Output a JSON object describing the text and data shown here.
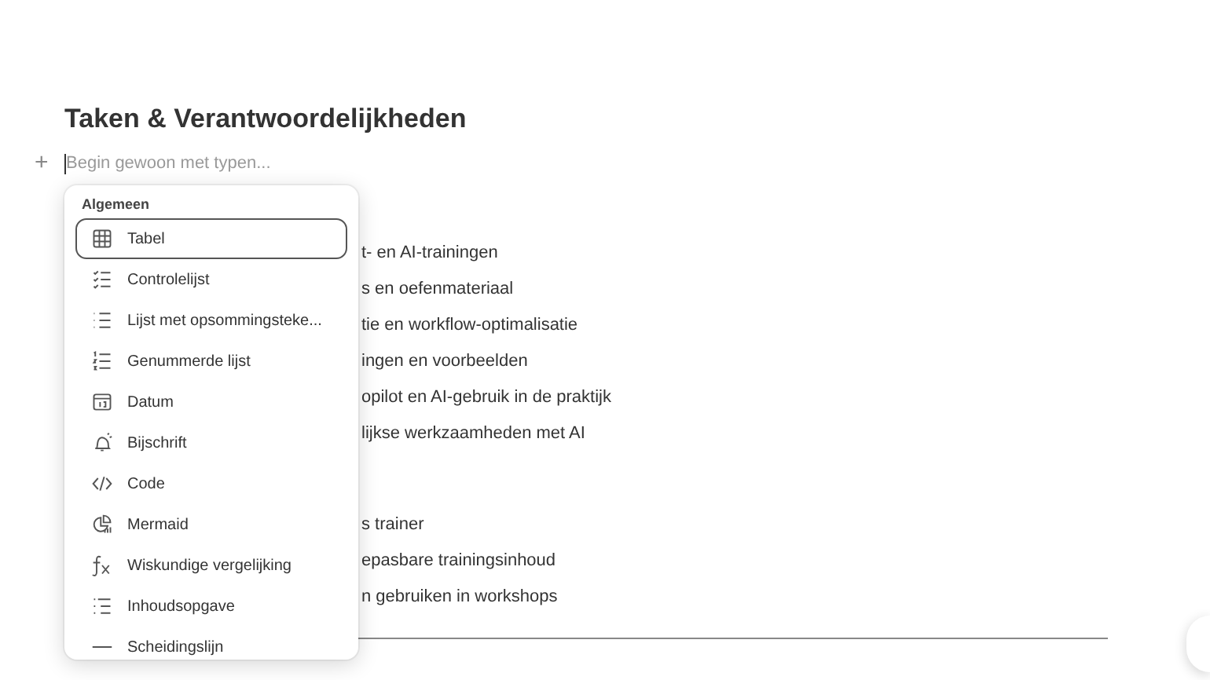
{
  "page": {
    "title": "Taken & Verantwoordelijkheden",
    "placeholder": "Begin gewoon met typen...",
    "add_symbol": "+"
  },
  "background_blocks": [
    {
      "lines": [
        "t- en AI-trainingen",
        "s en oefenmateriaal",
        "tie en workflow-optimalisatie",
        "ingen en voorbeelden",
        "opilot en AI-gebruik in de praktijk",
        "lijkse werkzaamheden met AI"
      ]
    },
    {
      "lines": [
        "s trainer",
        "epasbare trainingsinhoud",
        "n gebruiken in workshops"
      ]
    }
  ],
  "menu": {
    "section": "Algemeen",
    "items": [
      {
        "label": "Tabel",
        "kind": "table",
        "selected": true
      },
      {
        "label": "Controlelijst",
        "kind": "checklist",
        "selected": false
      },
      {
        "label": "Lijst met opsommingsteke...",
        "kind": "bullets",
        "selected": false
      },
      {
        "label": "Genummerde lijst",
        "kind": "numbered",
        "selected": false
      },
      {
        "label": "Datum",
        "kind": "date",
        "selected": false
      },
      {
        "label": "Bijschrift",
        "kind": "callout",
        "selected": false
      },
      {
        "label": "Code",
        "kind": "code",
        "selected": false
      },
      {
        "label": "Mermaid",
        "kind": "mermaid",
        "selected": false
      },
      {
        "label": "Wiskundige vergelijking",
        "kind": "math",
        "selected": false
      },
      {
        "label": "Inhoudsopgave",
        "kind": "toc",
        "selected": false
      },
      {
        "label": "Scheidingslijn",
        "kind": "divider",
        "selected": false
      }
    ]
  }
}
